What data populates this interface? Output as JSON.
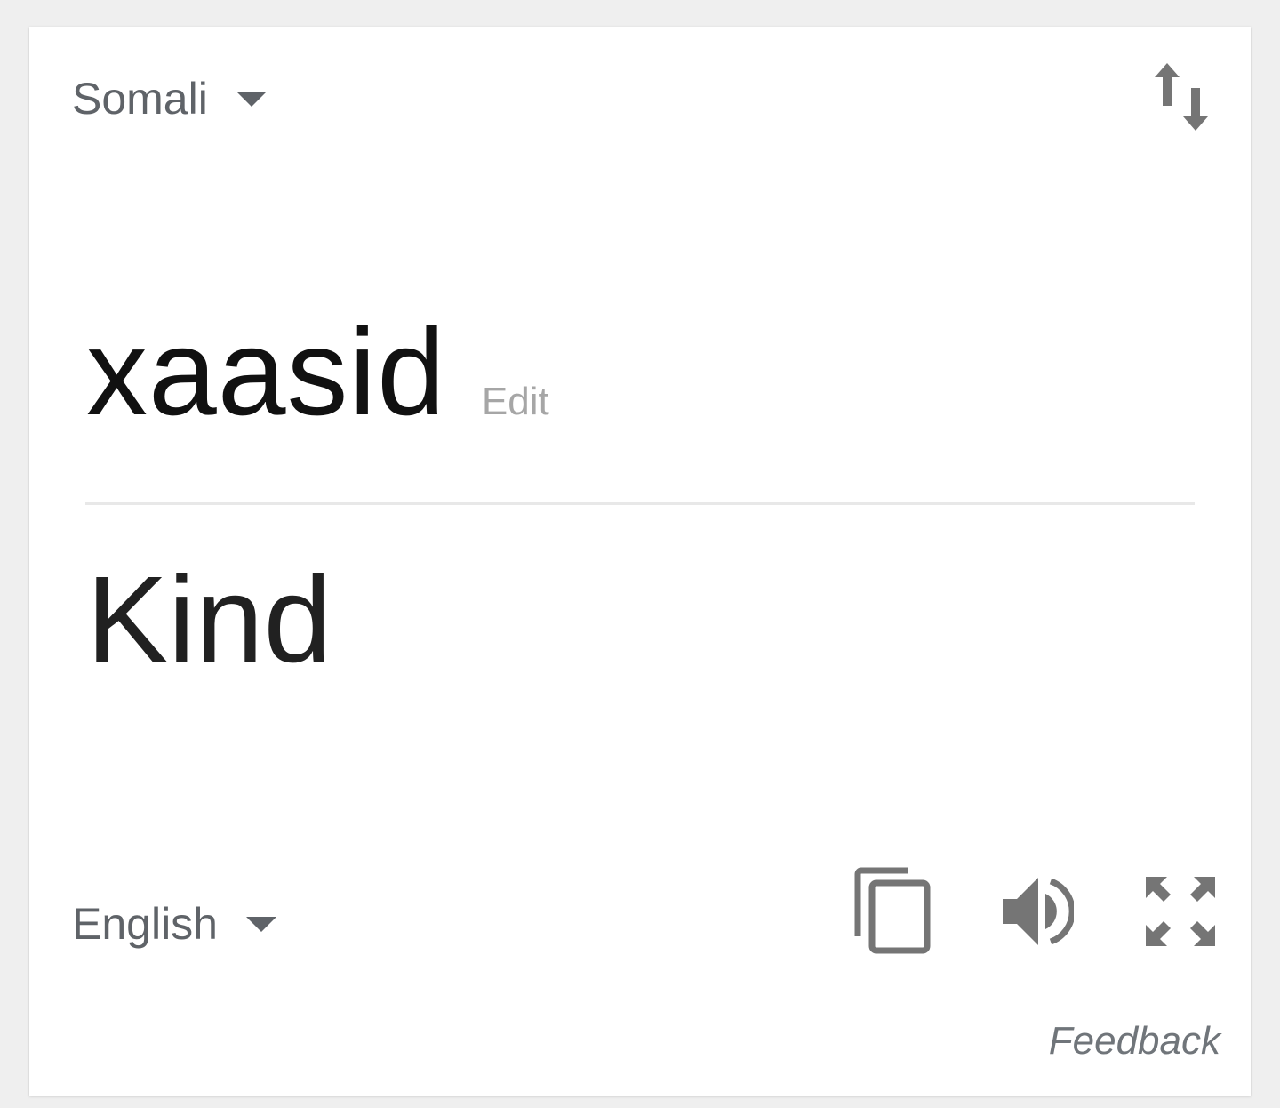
{
  "source": {
    "language": "Somali",
    "text": "xaasid",
    "edit_label": "Edit"
  },
  "target": {
    "language": "English",
    "text": "Kind"
  },
  "actions": {
    "swap_icon": "swap-vertical-icon",
    "copy_icon": "copy-icon",
    "speaker_icon": "speaker-icon",
    "fullscreen_icon": "fullscreen-icon"
  },
  "feedback_label": "Feedback",
  "colors": {
    "icon": "#757575",
    "text_primary": "#111111",
    "text_secondary": "#5f6368",
    "edit": "#a6a6a6"
  }
}
